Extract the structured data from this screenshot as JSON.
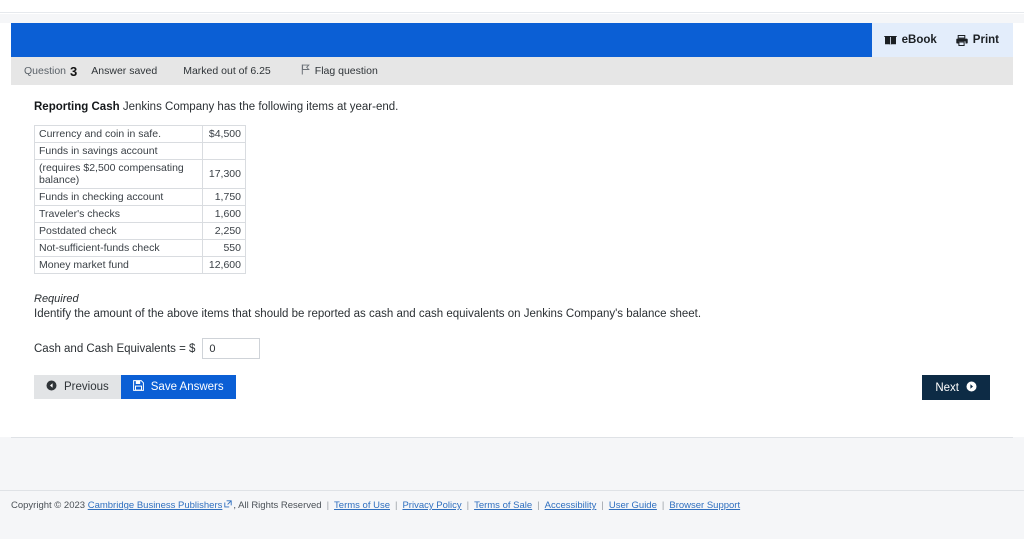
{
  "header": {
    "ebook_label": "eBook",
    "print_label": "Print",
    "accent_blue": "#0b5fd5",
    "tools_bg": "#e3edfb"
  },
  "question_bar": {
    "question_label": "Question",
    "question_number": "3",
    "status": "Answer saved",
    "marked_out_of": "Marked out of 6.25",
    "flag_label": "Flag question"
  },
  "question": {
    "title": "Reporting Cash",
    "prompt": "Jenkins Company has the following items at year-end.",
    "table": {
      "rows": [
        {
          "label": "Currency and coin in safe.",
          "amount": "$4,500"
        },
        {
          "label": "Funds in savings account",
          "amount": ""
        },
        {
          "label": "(requires $2,500 compensating balance)",
          "amount": "17,300"
        },
        {
          "label": "Funds in checking account",
          "amount": "1,750"
        },
        {
          "label": "Traveler's checks",
          "amount": "1,600"
        },
        {
          "label": "Postdated check",
          "amount": "2,250"
        },
        {
          "label": "Not-sufficient-funds check",
          "amount": "550"
        },
        {
          "label": "Money market fund",
          "amount": "12,600"
        }
      ]
    },
    "required_heading": "Required",
    "required_text": "Identify the amount of the above items that should be reported as cash and cash equivalents on Jenkins Company's balance sheet.",
    "answer_label": "Cash and Cash Equivalents = $",
    "answer_value": "0",
    "answer_placeholder": ""
  },
  "actions": {
    "previous_label": "Previous",
    "save_label": "Save Answers",
    "next_label": "Next"
  },
  "footer": {
    "copyright_prefix": "Copyright © 2023",
    "company": "Cambridge Business Publishers",
    "copyright_suffix": ", All Rights Reserved",
    "links": [
      "Terms of Use",
      "Privacy Policy",
      "Terms of Sale",
      "Accessibility",
      "User Guide",
      "Browser Support"
    ]
  }
}
